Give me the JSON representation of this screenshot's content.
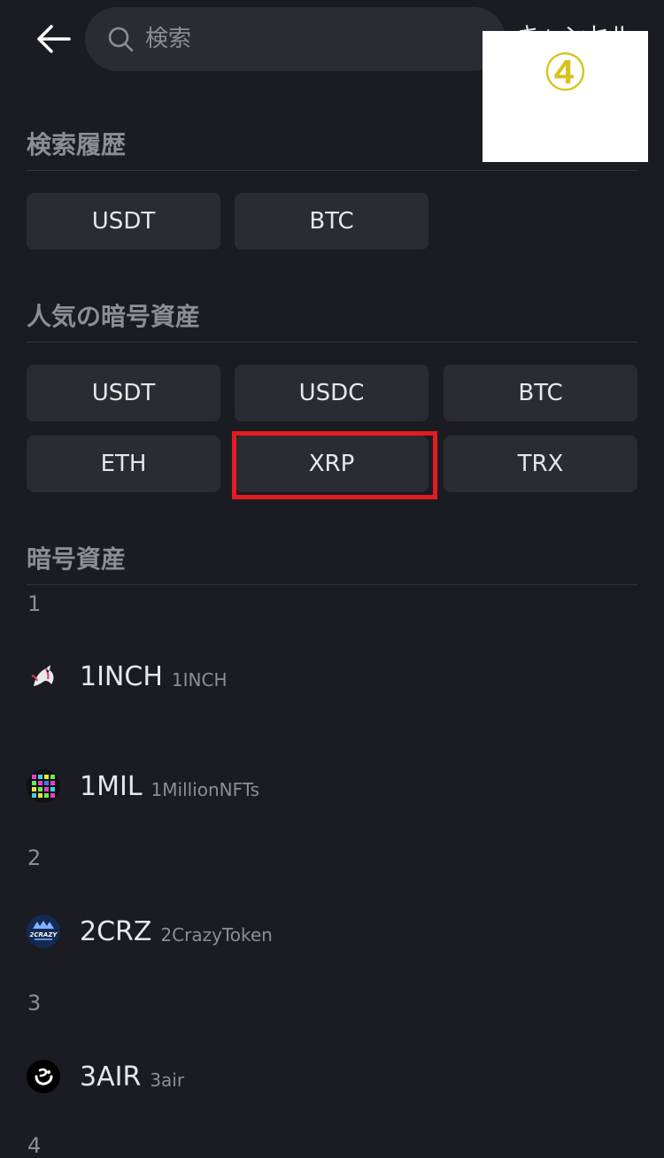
{
  "search": {
    "placeholder": "検索",
    "cancel_label": "キャンセル"
  },
  "overlay": {
    "label": "④"
  },
  "history": {
    "title": "検索履歴",
    "items": [
      "USDT",
      "BTC"
    ]
  },
  "popular": {
    "title": "人気の暗号資産",
    "items": [
      "USDT",
      "USDC",
      "BTC",
      "ETH",
      "XRP",
      "TRX"
    ]
  },
  "assets": {
    "title": "暗号資産",
    "groups": [
      {
        "index": "1",
        "items": [
          {
            "symbol": "1INCH",
            "name": "1INCH",
            "icon": "unicorn-logo-icon"
          },
          {
            "symbol": "1MIL",
            "name": "1MillionNFTs",
            "icon": "pixel-grid-logo-icon"
          }
        ]
      },
      {
        "index": "2",
        "items": [
          {
            "symbol": "2CRZ",
            "name": "2CrazyToken",
            "icon": "2crazy-logo-icon",
            "logo_text": "2CRAZY"
          }
        ]
      },
      {
        "index": "3",
        "items": [
          {
            "symbol": "3AIR",
            "name": "3air",
            "icon": "3air-logo-icon"
          }
        ]
      },
      {
        "index": "4",
        "items": []
      }
    ]
  }
}
